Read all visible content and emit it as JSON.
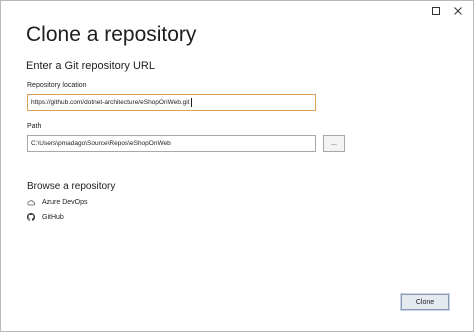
{
  "window": {
    "controls": [
      "maximize",
      "close"
    ]
  },
  "dialog": {
    "title": "Clone a repository",
    "subtitle": "Enter a Git repository URL"
  },
  "repository_location": {
    "label": "Repository location",
    "value": "https://github.com/dotnet-architecture/eShopOnWeb.git"
  },
  "path": {
    "label": "Path",
    "value": "C:\\Users\\pmadago\\Source\\Repos\\eShopOnWeb",
    "browse_label": "..."
  },
  "browse": {
    "title": "Browse a repository",
    "providers": [
      {
        "label": "Azure DevOps",
        "icon": "cloud-icon"
      },
      {
        "label": "GitHub",
        "icon": "github-icon"
      }
    ]
  },
  "actions": {
    "clone_label": "Clone"
  }
}
